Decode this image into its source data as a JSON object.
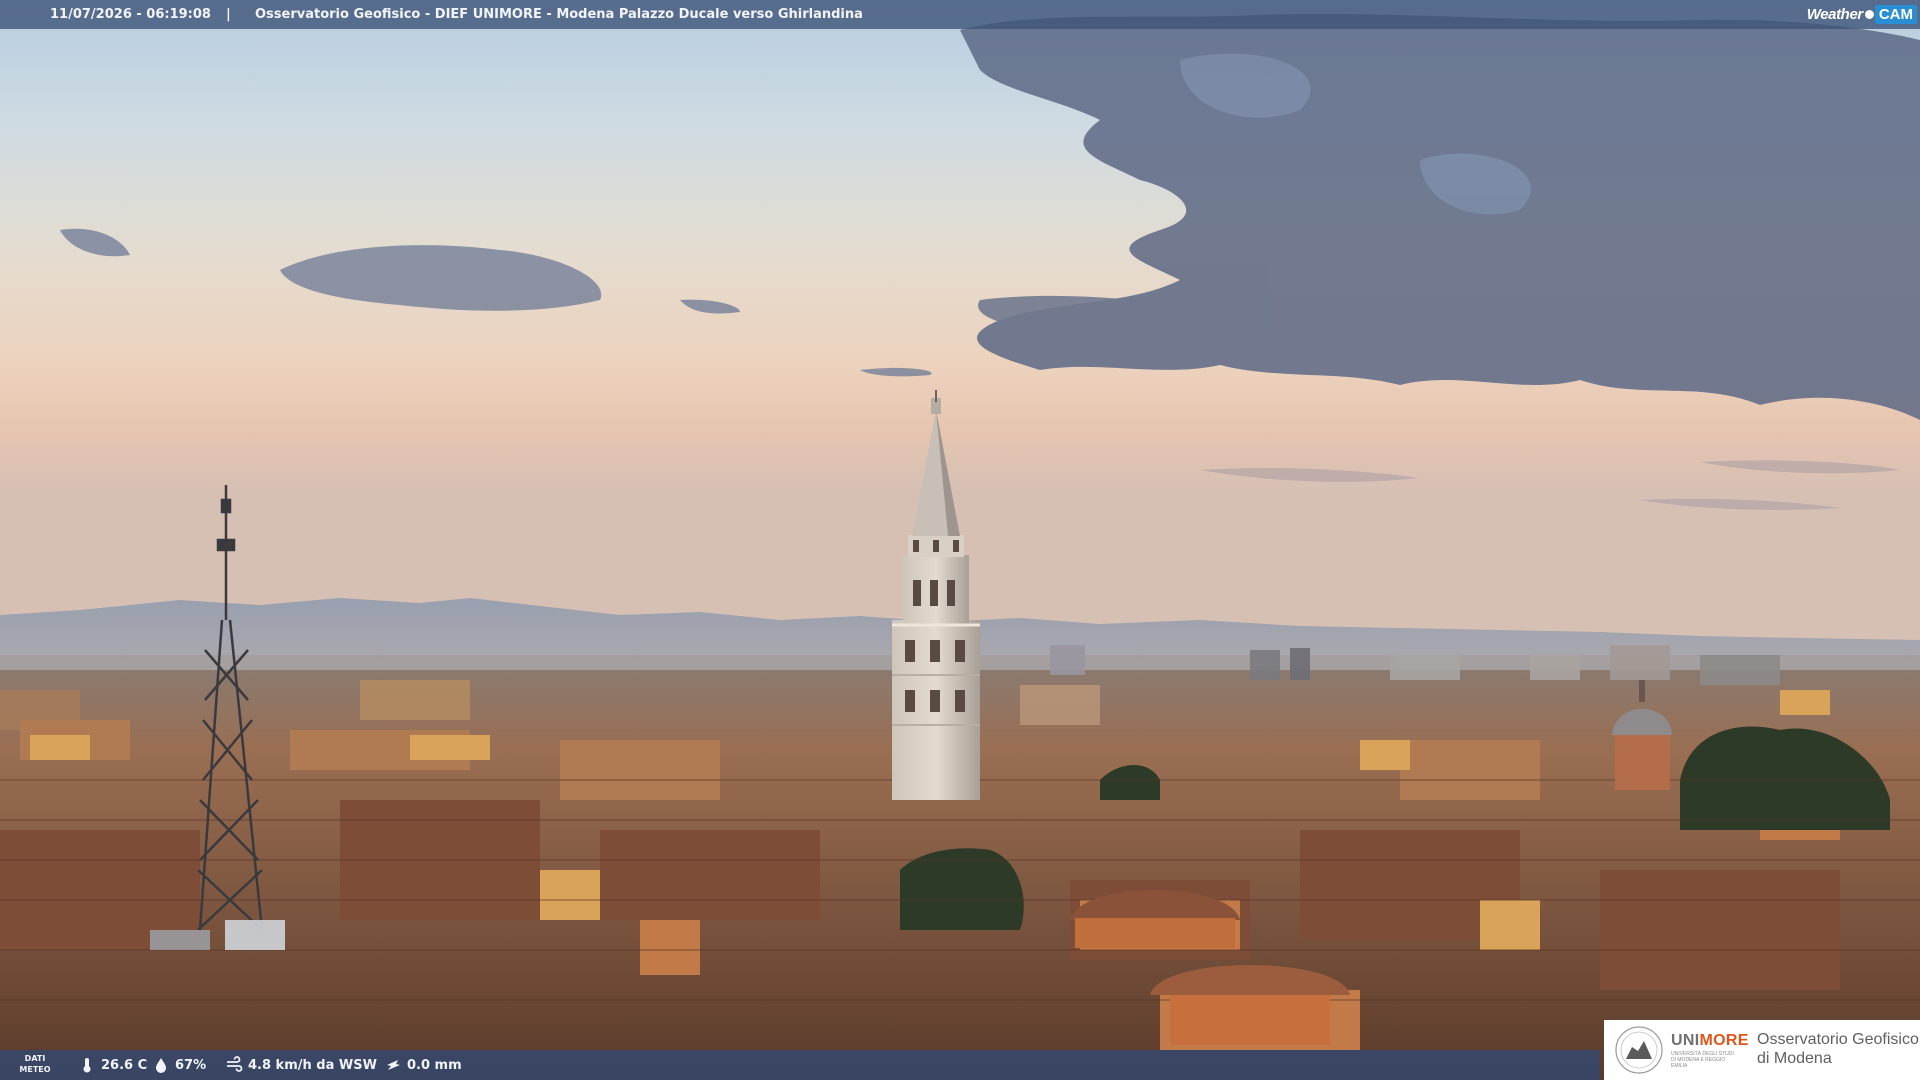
{
  "overlay": {
    "timestamp": "11/07/2026 - 06:19:08",
    "separator": "|",
    "location": "Osservatorio Geofisico - DIEF UNIMORE - Modena Palazzo Ducale verso Ghirlandina",
    "brand": {
      "weather": "Weather",
      "cam": "CAM",
      "accent": "#2a8ed4"
    }
  },
  "weather_data": {
    "label_line1": "DATI",
    "label_line2": "METEO",
    "temperature": "26.6 C",
    "humidity": "67%",
    "wind": "4.8 km/h da WSW",
    "rain": "0.0 mm",
    "icons": [
      "thermometer-icon",
      "humidity-drop-icon",
      "wind-icon",
      "rain-gauge-icon"
    ]
  },
  "logo": {
    "uni_part1": "UNI",
    "uni_part2": "MORE",
    "uni_subtitle": "UNIVERSITÀ DEGLI STUDI DI MODENA E REGGIO EMILIA",
    "observatory_line1": "Osservatorio Geofisico",
    "observatory_line2": "di Modena",
    "accent": "#e0561a"
  },
  "colors": {
    "sky_top": "#bfd3e0",
    "sky_horizon": "#e9c9b2",
    "clouds": "#5e6a86",
    "roofs": "#9b6446",
    "bar": "#3e5478"
  }
}
